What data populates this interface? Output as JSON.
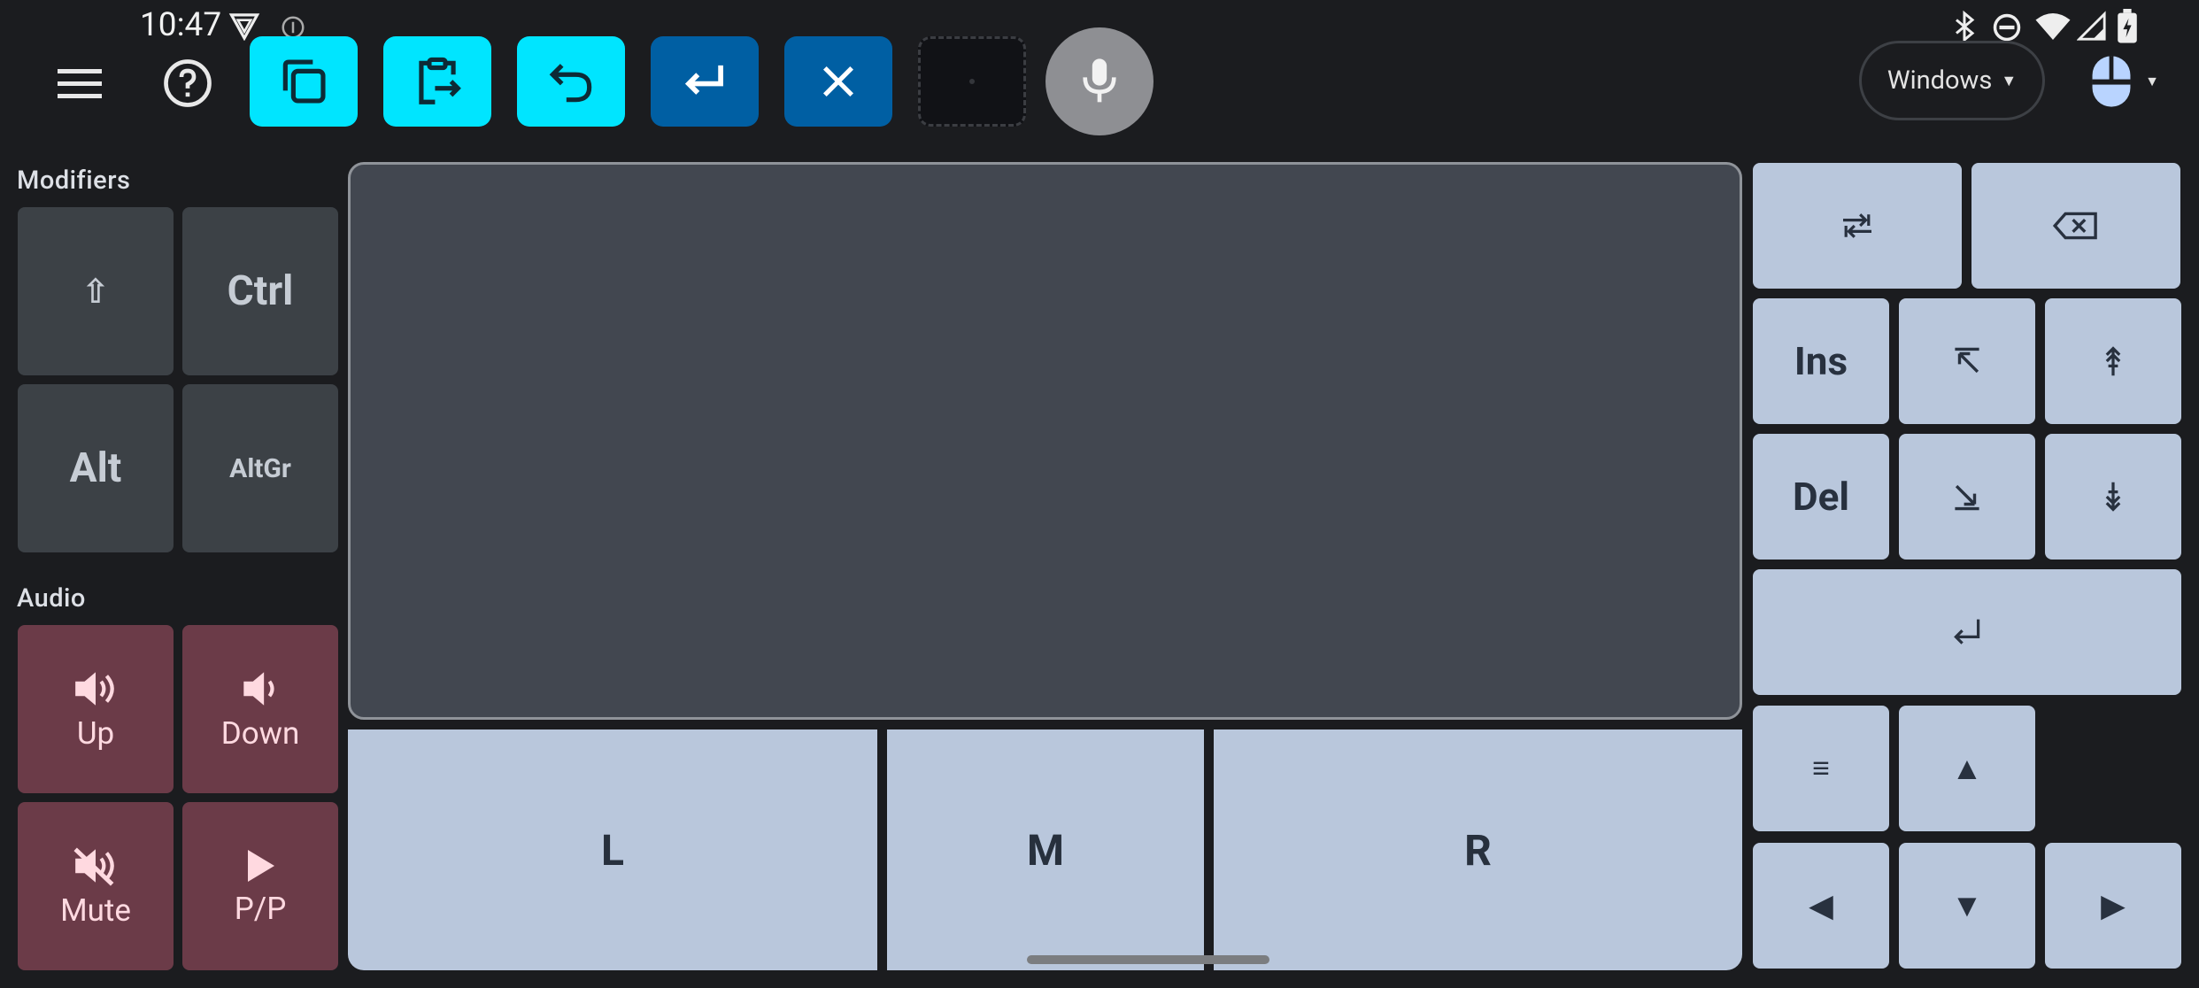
{
  "status_bar": {
    "time": "10:47",
    "icons": [
      "bluetooth-icon",
      "do-not-disturb-icon",
      "wifi-icon",
      "signal-icon",
      "battery-charging-icon"
    ]
  },
  "toolbar": {
    "os_selector": "Windows",
    "buttons": [
      "menu-icon",
      "help-icon",
      "copy-icon",
      "paste-icon",
      "undo-icon",
      "enter-icon",
      "close-icon",
      "microphone-icon",
      "mouse-icon"
    ]
  },
  "modifiers": {
    "title": "Modifiers",
    "shift": "⇧",
    "ctrl": "Ctrl",
    "alt": "Alt",
    "altgr": "AltGr"
  },
  "audio": {
    "title": "Audio",
    "up": "Up",
    "down": "Down",
    "mute": "Mute",
    "pp": "P/P"
  },
  "mouse_buttons": {
    "left": "L",
    "middle": "M",
    "right": "R"
  },
  "keys": {
    "tab": "⭾",
    "backspace": "⌫",
    "ins": "Ins",
    "home": "⇱",
    "pgup": "⇞",
    "del": "Del",
    "end": "⇲",
    "pgdn": "⇟",
    "enter": "⏎",
    "menu": "≡",
    "up": "▲",
    "left": "◀",
    "down": "▼",
    "right": "▶"
  },
  "colors": {
    "accent_cyan": "#00e5ff",
    "accent_blue": "#005fa3",
    "audio_bg": "#6b3b48",
    "key_bg": "#b9c7dc"
  }
}
